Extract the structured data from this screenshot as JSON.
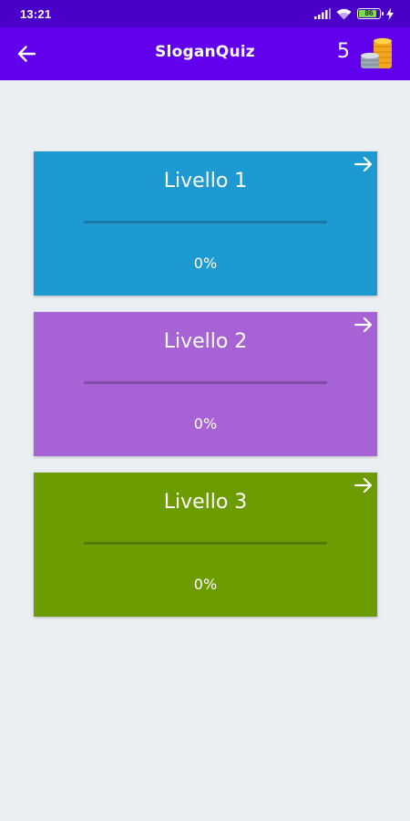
{
  "status_bar": {
    "time": "13:21",
    "battery_level": "86"
  },
  "app_bar": {
    "title": "SloganQuiz",
    "coins": "5",
    "back_icon": "arrow-left-icon",
    "coins_icon": "coins-stack-icon"
  },
  "levels": [
    {
      "title": "Livello 1",
      "percent_label": "0%",
      "progress": 0,
      "color": "#1e9ad2"
    },
    {
      "title": "Livello 2",
      "percent_label": "0%",
      "progress": 0,
      "color": "#a763d6"
    },
    {
      "title": "Livello 3",
      "percent_label": "0%",
      "progress": 0,
      "color": "#6c9c00"
    }
  ],
  "colors": {
    "status_bar": "#4a00c8",
    "app_bar": "#6200ee",
    "background": "#ebeff3"
  }
}
